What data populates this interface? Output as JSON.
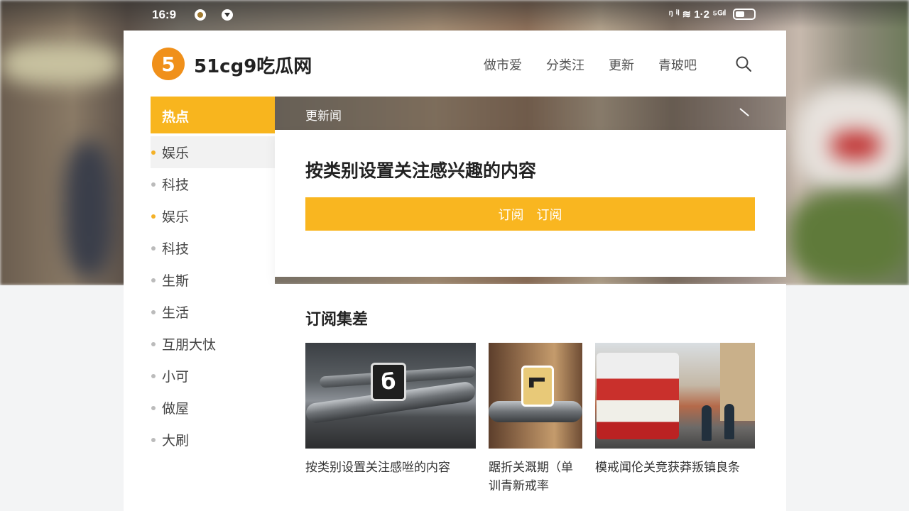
{
  "status_bar": {
    "time": "16:9",
    "right_text": "ᵑ ⁱˡ  ≋  1·2 ⁵ᴳᶦˡ"
  },
  "header": {
    "logo_letter": "5",
    "site_name": "51cg9吃瓜网",
    "nav": [
      "做市爱",
      "分类汪",
      "更新",
      "青玻吧"
    ],
    "accent_color": "#f8b51e",
    "logo_color": "#f0901a"
  },
  "sidebar": {
    "heading": "热点",
    "items": [
      {
        "label": "娱乐",
        "bullet": "orange",
        "active": true
      },
      {
        "label": "科技",
        "bullet": "gray"
      },
      {
        "label": "娱乐",
        "bullet": "orange"
      },
      {
        "label": "科技",
        "bullet": "gray"
      },
      {
        "label": "生斯",
        "bullet": "gray"
      },
      {
        "label": "生活",
        "bullet": "gray"
      },
      {
        "label": "互朋大忲",
        "bullet": "gray"
      },
      {
        "label": "小可",
        "bullet": "gray"
      },
      {
        "label": "做屋",
        "bullet": "gray"
      },
      {
        "label": "大刷",
        "bullet": "gray"
      }
    ]
  },
  "update_bar": {
    "label": "更新闻"
  },
  "subscribe": {
    "title": "按类别设置关注感兴趣的内容",
    "button_word_1": "订阅",
    "button_word_2": "订阅"
  },
  "content": {
    "section_title": "订阅集差",
    "cards": [
      {
        "caption": "按类别设置关注感咝的内容",
        "image": "pipe-with-black-sign"
      },
      {
        "caption": "踞折关溉期（单训青新戒率",
        "image": "pipe-with-yellow-sign"
      },
      {
        "caption": "模戒闻伦关竞获莽叛镇良条",
        "image": "double-decker-bus-street"
      }
    ],
    "thumb_sign_1": "б"
  }
}
